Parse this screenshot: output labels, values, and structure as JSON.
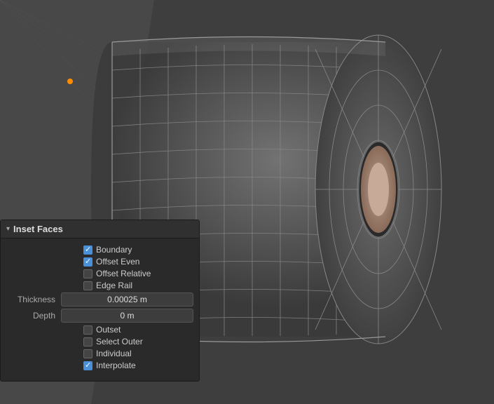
{
  "panel": {
    "title": "Inset Faces",
    "arrow": "▾",
    "options": {
      "boundary_label": "Boundary",
      "boundary_checked": true,
      "offset_even_label": "Offset Even",
      "offset_even_checked": true,
      "offset_relative_label": "Offset Relative",
      "offset_relative_checked": false,
      "edge_rail_label": "Edge Rail",
      "edge_rail_checked": false,
      "thickness_label": "Thickness",
      "thickness_value": "0.00025 m",
      "depth_label": "Depth",
      "depth_value": "0 m",
      "outset_label": "Outset",
      "outset_checked": false,
      "select_outer_label": "Select Outer",
      "select_outer_checked": false,
      "individual_label": "Individual",
      "individual_checked": false,
      "interpolate_label": "Interpolate",
      "interpolate_checked": true
    }
  },
  "viewport": {
    "orange_dot": true
  }
}
